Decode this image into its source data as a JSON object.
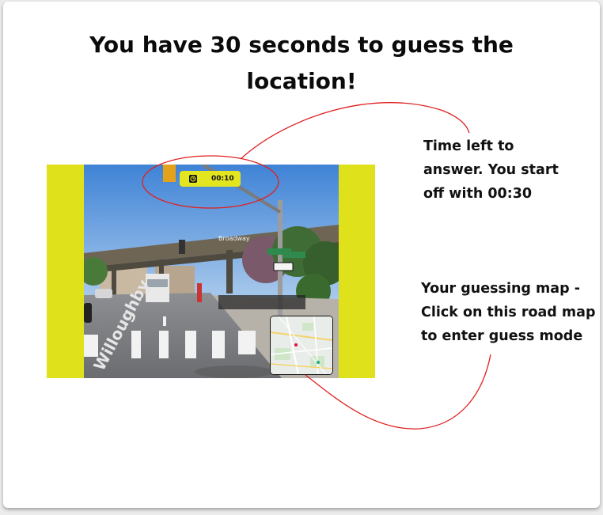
{
  "header": {
    "title": "You have 30 seconds to guess the location!"
  },
  "game": {
    "timer": {
      "value": "00:10",
      "icon": "clock-icon"
    },
    "street_sign": "Broadway",
    "street_marking": "Willoughby",
    "accent_color": "#dfe21a"
  },
  "annotations": {
    "timer_note": "Time left to answer. You start off with 00:30",
    "map_note": "Your guessing map - Click on this road map to enter guess mode"
  }
}
